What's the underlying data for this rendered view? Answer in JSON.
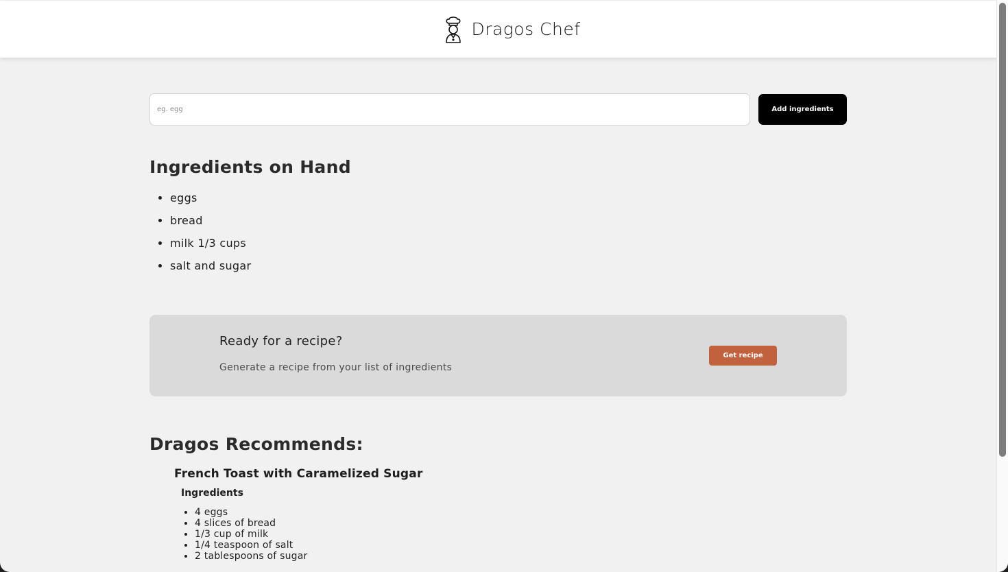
{
  "header": {
    "brand_title": "Dragos Chef",
    "brand_icon": "chef-icon"
  },
  "add_form": {
    "input_placeholder": "eg. egg",
    "input_value": "",
    "add_button_label": "Add ingredients"
  },
  "on_hand": {
    "title": "Ingredients on Hand",
    "items": [
      "eggs",
      "bread",
      "milk 1/3 cups",
      "salt and sugar"
    ]
  },
  "recipe_cta": {
    "heading": "Ready for a recipe?",
    "text": "Generate a recipe from your list of ingredients",
    "button_label": "Get recipe"
  },
  "recommendation": {
    "title": "Dragos Recommends:",
    "recipe_name": "French Toast with Caramelized Sugar",
    "ingredients_heading": "Ingredients",
    "ingredients": [
      "4 eggs",
      "4 slices of bread",
      "1/3 cup of milk",
      "1/4 teaspoon of salt",
      "2 tablespoons of sugar"
    ]
  },
  "colors": {
    "page_background": "#f1f1f1",
    "header_background": "#ffffff",
    "primary_button": "#000000",
    "accent_button": "#c2613d",
    "cta_background": "#dadada"
  }
}
